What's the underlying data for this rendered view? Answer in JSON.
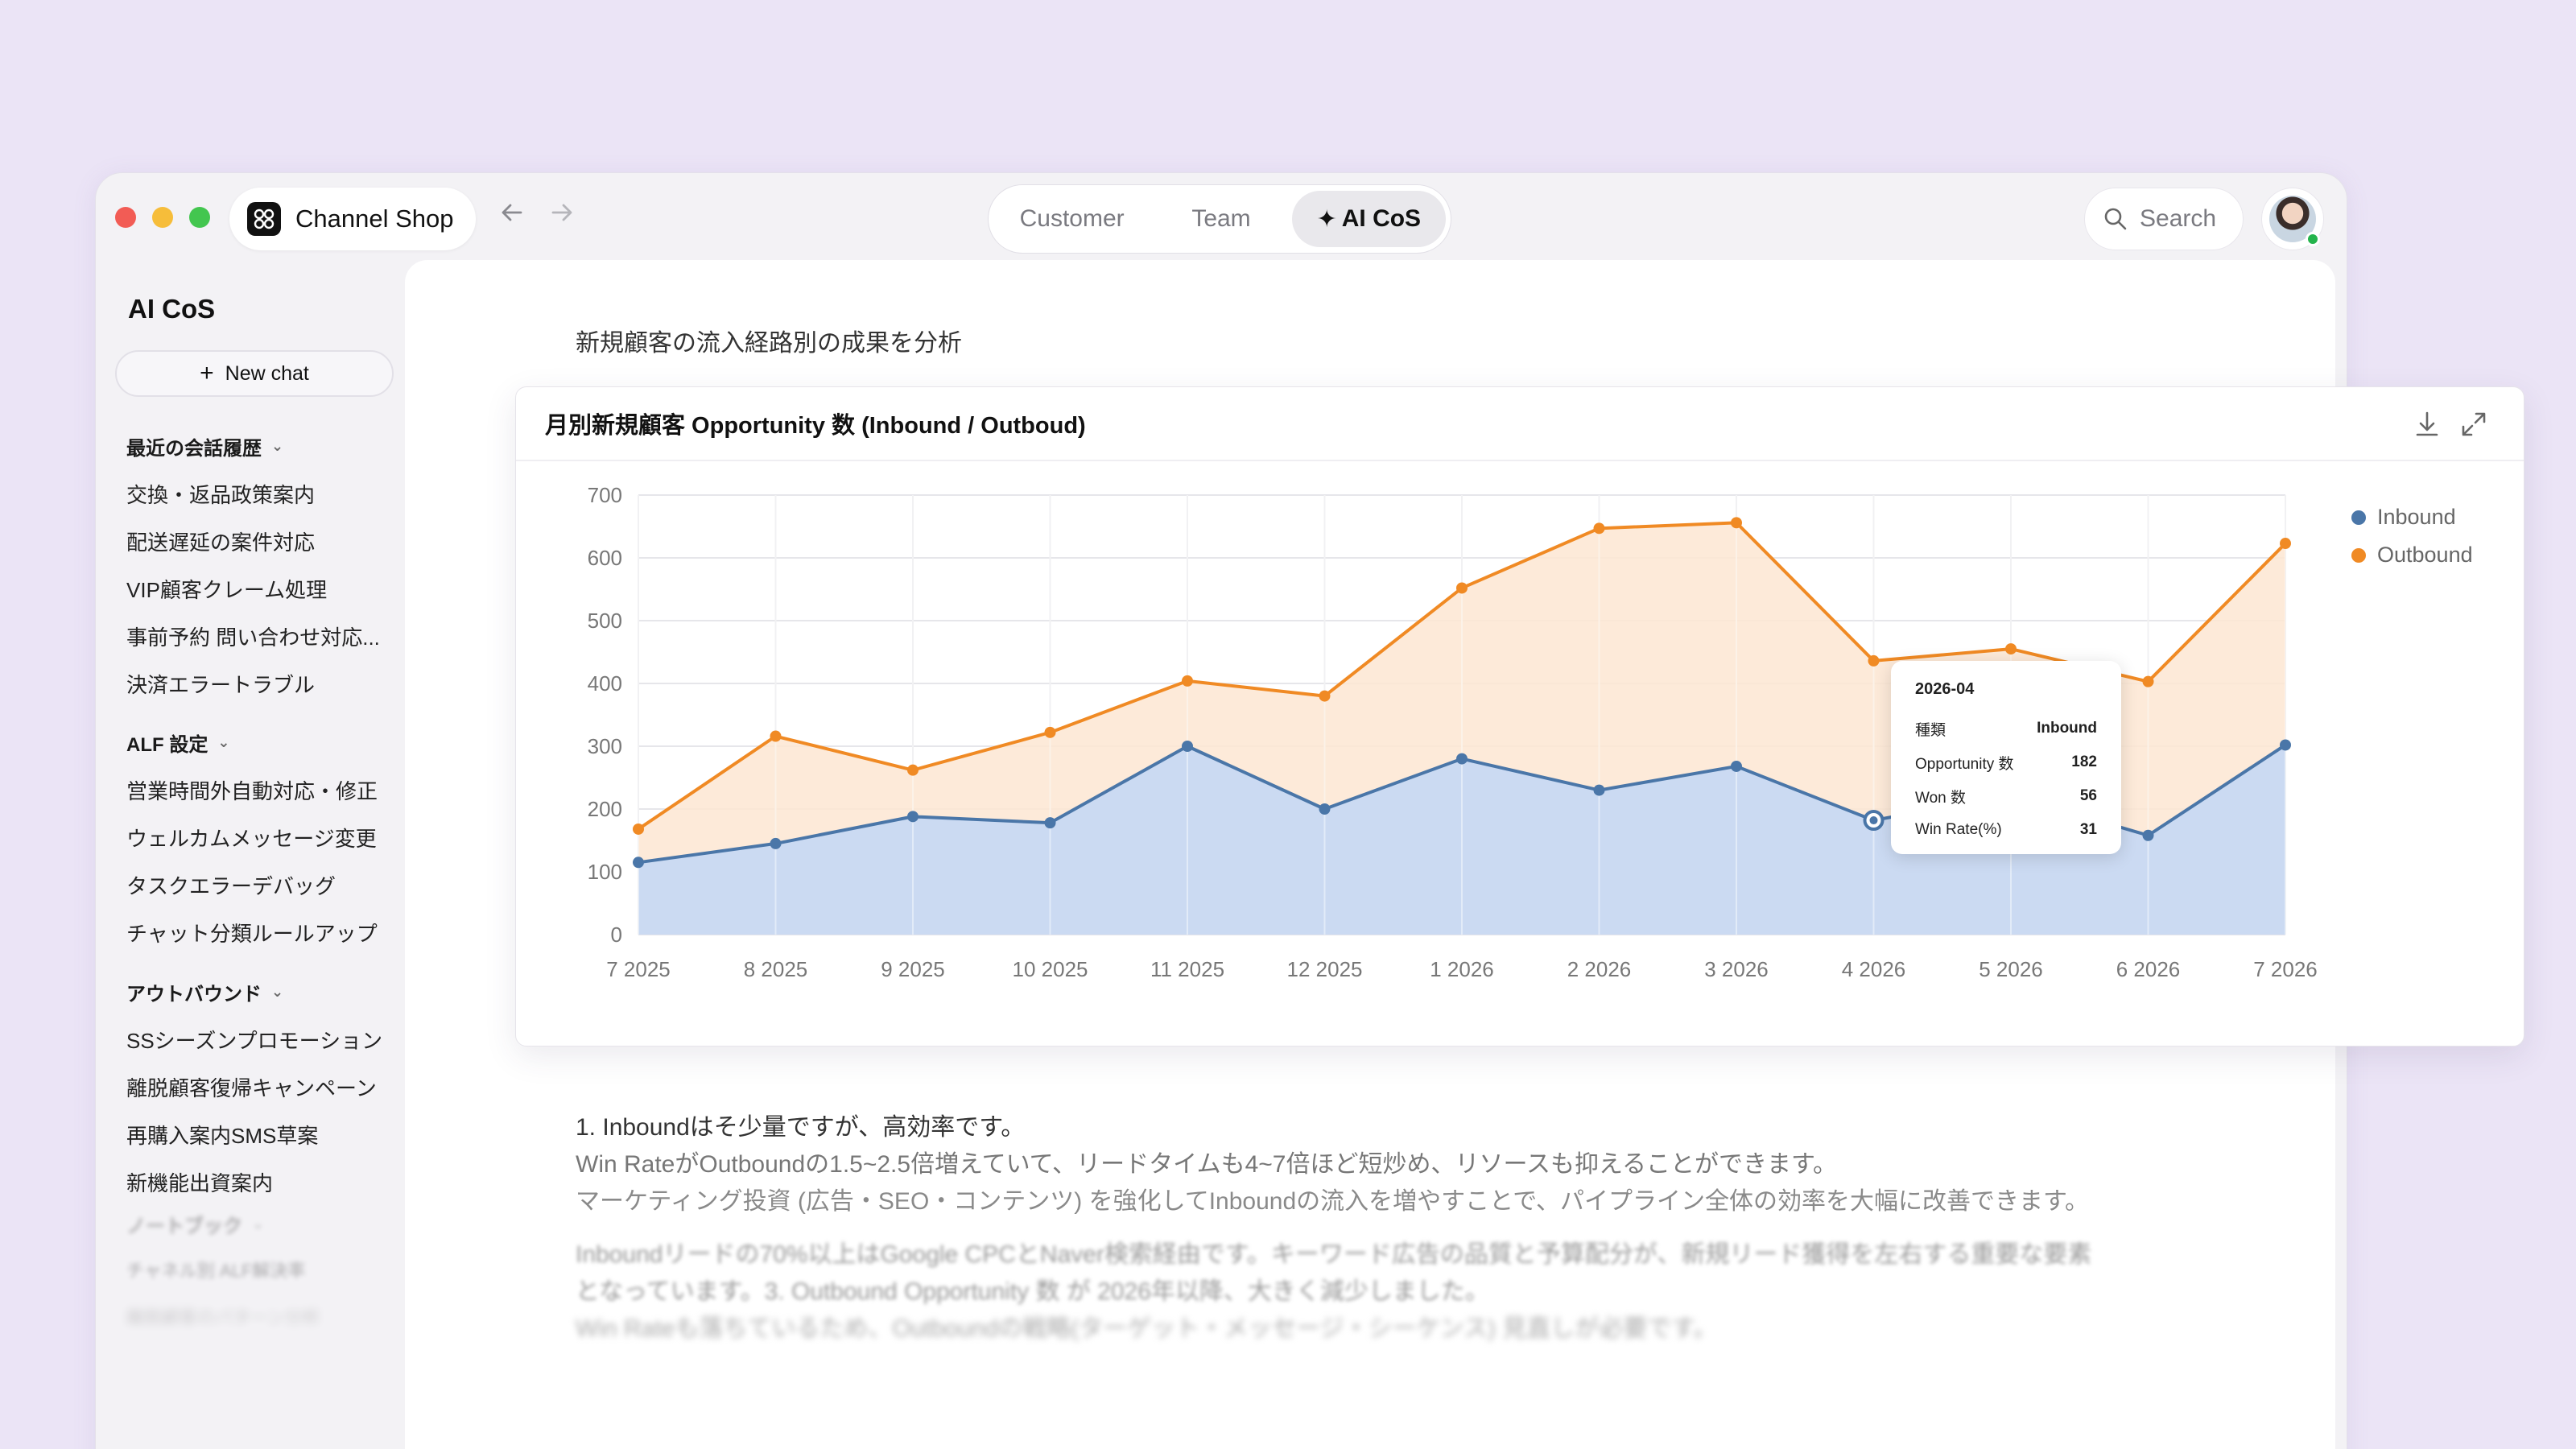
{
  "app": {
    "title": "Channel Shop"
  },
  "tabs": [
    {
      "label": "Customer",
      "active": false
    },
    {
      "label": "Team",
      "active": false
    },
    {
      "label": "AI CoS",
      "active": true
    }
  ],
  "search": {
    "label": "Search"
  },
  "sidebar": {
    "title": "AI CoS",
    "new_chat": "New chat",
    "sections": [
      {
        "label": "最近の会話履歴",
        "items": [
          "交換・返品政策案内",
          "配送遅延の案件対応",
          "VIP顧客クレーム処理",
          "事前予約 問い合わせ対応...",
          "決済エラートラブル"
        ]
      },
      {
        "label": "ALF 設定",
        "items": [
          "営業時間外自動対応・修正",
          "ウェルカムメッセージ変更",
          "タスクエラーデバッグ",
          "チャット分類ルールアップ"
        ]
      },
      {
        "label": "アウトバウンド",
        "items": [
          "SSシーズンプロモーション",
          "離脱顧客復帰キャンペーン",
          "再購入案内SMS草案",
          "新機能出資案内"
        ]
      },
      {
        "label": "ノートブック",
        "items": [
          "チャネル別 ALF解決率",
          "離脱顧客のパターン分析"
        ]
      }
    ]
  },
  "main": {
    "heading": "新規顧客の流入経路別の成果を分析",
    "answer_lines": [
      "1. Inboundはそ少量ですが、高効率です。",
      "Win RateがOutboundの1.5~2.5倍増えていて、リードタイムも4~7倍ほど短炒め、リソースも抑えることができます。",
      "マーケティング投資 (広告・SEO・コンテンツ) を強化してInboundの流入を増やすことで、パイプライン全体の効率を大幅に改善できます。",
      "Inboundリードの70%以上はGoogle CPCとNaver検索経由です。キーワード広告の品質と予算配分が、新規リード獲得を左右する重要な要素",
      "となっています。3. Outbound Opportunity 数 が 2026年以降、大きく減少しました。",
      "Win Rateも落ちているため、Outboundの戦略(ターゲット・メッセージ・シーケンス) 見直しが必要です。"
    ]
  },
  "chart_data": {
    "type": "area",
    "title": "月別新規顧客 Opportunity 数 (Inbound / Outboud)",
    "categories": [
      "7 2025",
      "8 2025",
      "9 2025",
      "10 2025",
      "11 2025",
      "12 2025",
      "1 2026",
      "2 2026",
      "3 2026",
      "4 2026",
      "5 2026",
      "6 2026",
      "7 2026"
    ],
    "yticks": [
      "0",
      "100",
      "200",
      "300",
      "400",
      "500",
      "600",
      "700"
    ],
    "ylim": [
      0,
      700
    ],
    "series": [
      {
        "name": "Inbound",
        "color": "#4a76a8",
        "fill": "#c8d9f3",
        "values": [
          115,
          145,
          188,
          178,
          300,
          200,
          280,
          230,
          268,
          182,
          222,
          158,
          302
        ]
      },
      {
        "name": "Outbound",
        "color": "#f08a24",
        "fill": "#fde6d2",
        "values": [
          168,
          316,
          262,
          322,
          404,
          380,
          552,
          647,
          656,
          436,
          455,
          403,
          623
        ]
      }
    ],
    "legend_position": "right",
    "grid": true,
    "tooltip": {
      "title": "2026-04",
      "rows": [
        {
          "label": "種類",
          "value": "Inbound"
        },
        {
          "label": "Opportunity 数",
          "value": "182"
        },
        {
          "label": "Won 数",
          "value": "56"
        },
        {
          "label": "Win Rate(%)",
          "value": "31"
        }
      ]
    }
  }
}
